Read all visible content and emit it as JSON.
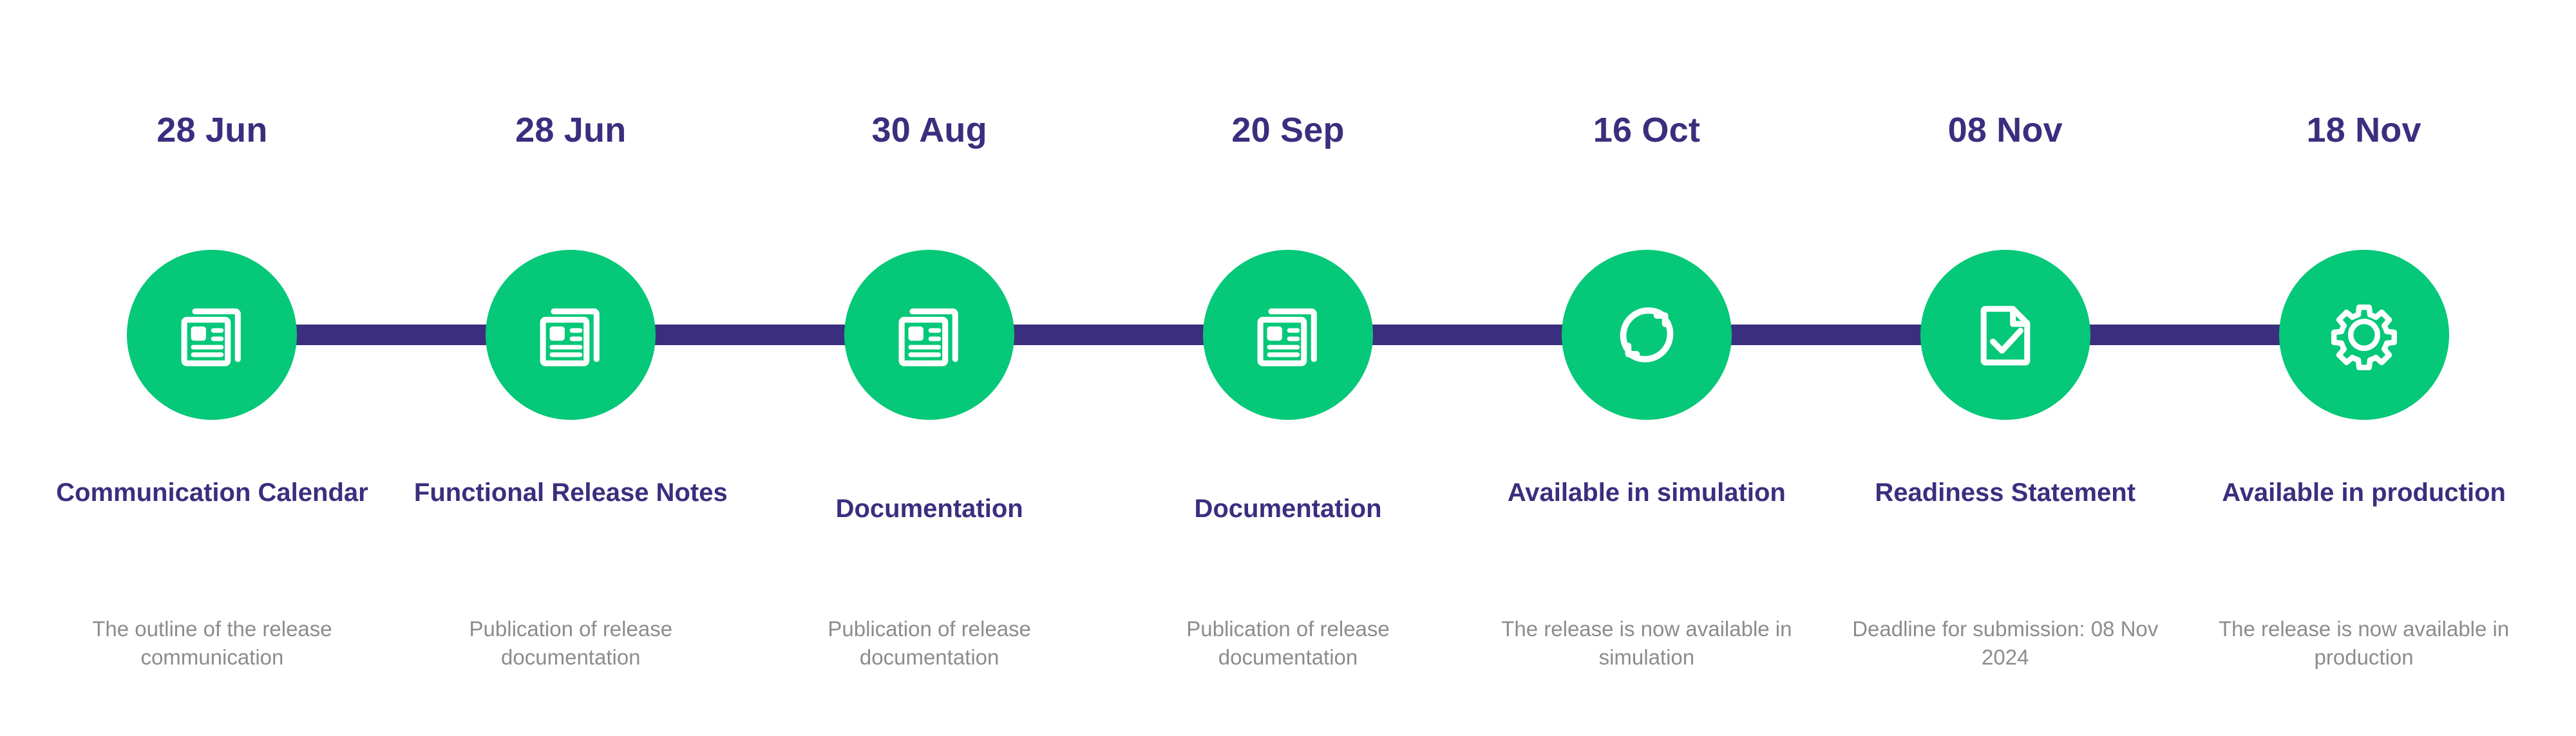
{
  "theme": {
    "background": "#FFFFFF",
    "accent_green": "#05C878",
    "accent_purple": "#3B2E7E",
    "subtitle_gray": "#8C8C8C",
    "icon_color": "#FFFFFF"
  },
  "timeline": {
    "orientation": "horizontal",
    "connector_color": "#3B2E7E",
    "milestones": [
      {
        "date": "28 Jun",
        "title": "Communication Calendar",
        "subtitle": "The outline of the release communication",
        "icon": "newspaper-icon",
        "single_line_title": false
      },
      {
        "date": "28 Jun",
        "title": "Functional Release Notes",
        "subtitle": "Publication of release documentation",
        "icon": "newspaper-icon",
        "single_line_title": false
      },
      {
        "date": "30 Aug",
        "title": "Documentation",
        "subtitle": "Publication of release documentation",
        "icon": "newspaper-icon",
        "single_line_title": true
      },
      {
        "date": "20 Sep",
        "title": "Documentation",
        "subtitle": "Publication of release documentation",
        "icon": "newspaper-icon",
        "single_line_title": true
      },
      {
        "date": "16 Oct",
        "title": "Available in simulation",
        "subtitle": "The release is now available in simulation",
        "icon": "sync-refresh-icon",
        "single_line_title": false
      },
      {
        "date": "08 Nov",
        "title": "Readiness Statement",
        "subtitle": "Deadline for submission: 08 Nov 2024",
        "icon": "document-check-icon",
        "single_line_title": false
      },
      {
        "date": "18 Nov",
        "title": "Available in production",
        "subtitle": "The release is now available in production",
        "icon": "gear-icon",
        "single_line_title": false
      }
    ]
  }
}
